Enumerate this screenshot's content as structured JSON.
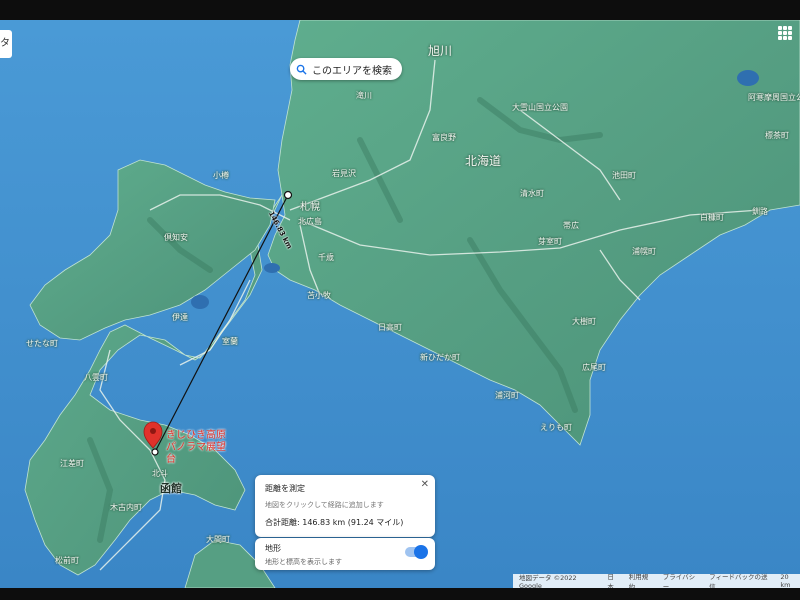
{
  "edge_tab": {
    "label": "タ"
  },
  "search_area_button": {
    "label": "このエリアを検索"
  },
  "distance_label": "146.83 km",
  "place_labels": {
    "asahikawa": "旭川",
    "takikawa": "滝川",
    "iwamizawa": "岩見沢",
    "sapporo": "札幌",
    "otaru": "小樽",
    "kitahiroshima": "北広島",
    "chitose": "千歳",
    "tomakomai": "苫小牧",
    "hokkaido": "北海道",
    "obihiro": "帯広",
    "kushiro": "釧路",
    "furano": "富良野",
    "hidaka": "日高町",
    "shin_hidaka": "新ひだか町",
    "urakawa": "浦河町",
    "erimo": "えりも町",
    "hiroo": "広尾町",
    "taiki": "大樹町",
    "niseko": "倶知安",
    "muroran": "室蘭",
    "date": "伊達",
    "yakumo": "八雲町",
    "esashi": "江差町",
    "kikonai": "木古内町",
    "matsumae": "松前町",
    "ohma": "大間町",
    "setana": "せたな町",
    "hakodate": "函館",
    "hokuto": "北斗",
    "daisetsuzan": "大雪山国立公園",
    "akan": "阿寒摩周国立公園",
    "shibecha": "標茶町",
    "shiranuka": "白糠町",
    "urahoro": "浦幌町",
    "ikeda": "池田町",
    "memuro": "芽室町",
    "shimizu": "清水町"
  },
  "pin": {
    "name": "きじひき高原パノラマ展望台"
  },
  "measure_panel": {
    "title": "距離を測定",
    "hint": "地図をクリックして経路に追加します",
    "total": "合計距離: 146.83 km (91.24 マイル)",
    "close_icon": "close-icon"
  },
  "terrain_panel": {
    "title": "地形",
    "description": "地形と標高を表示します",
    "enabled": true
  },
  "footer": {
    "attribution": "地図データ ©2022 Google",
    "region": "日本",
    "terms": "利用規約",
    "privacy": "プライバシー",
    "feedback": "フィードバックの送信",
    "scale": "20 km"
  },
  "colors": {
    "sea": "#3f8fcf",
    "land": "#5aa78a",
    "route_line": "#111111",
    "pin": "#e0322b",
    "toggle_on": "#1a73e8"
  }
}
